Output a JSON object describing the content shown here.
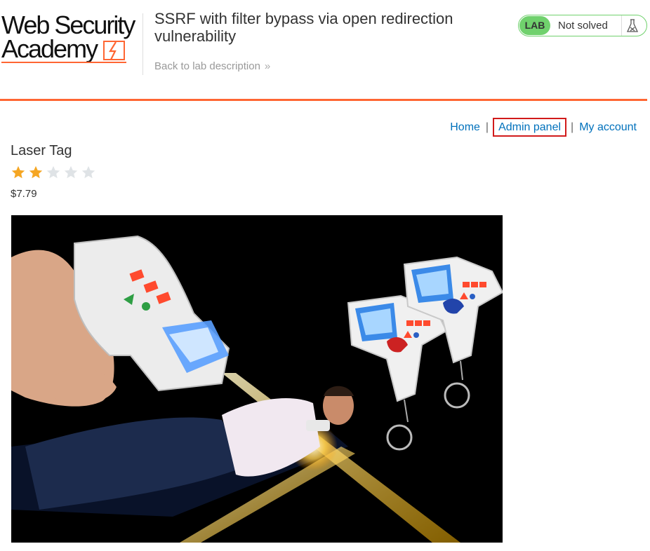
{
  "header": {
    "logo_line1": "Web Security",
    "logo_line2": "Academy",
    "lab_title": "SSRF with filter bypass via open redirection vulnerability",
    "back_link": "Back to lab description",
    "back_chevron": "»",
    "lab_badge": "LAB",
    "status": "Not solved",
    "status_icon": "flask-icon",
    "accent_color": "#ff6633",
    "status_color": "#70d16d"
  },
  "nav": {
    "items": [
      {
        "label": "Home"
      },
      {
        "label": "Admin panel",
        "highlighted": true
      },
      {
        "label": "My account"
      }
    ],
    "separator": "|"
  },
  "product": {
    "name": "Laser Tag",
    "rating": 2,
    "rating_max": 5,
    "price": "$7.79",
    "image_icon": "product-image"
  }
}
